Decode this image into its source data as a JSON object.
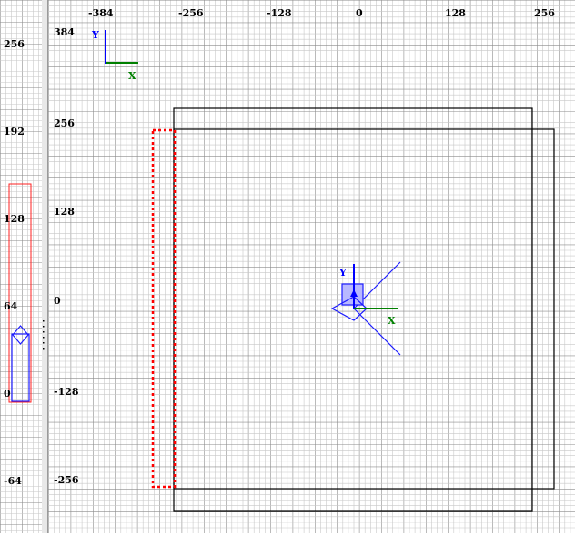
{
  "side_view": {
    "scale_labels": [
      "256",
      "192",
      "128",
      "64",
      "0",
      "-64"
    ]
  },
  "top_view": {
    "top_ruler": [
      "-384",
      "-256",
      "-128",
      "0",
      "128",
      "256"
    ],
    "left_ruler": [
      "384",
      "256",
      "128",
      "0",
      "-128",
      "-256"
    ],
    "corner_axis": {
      "y_label": "Y",
      "x_label": "X"
    },
    "origin_axis": {
      "y_label": "Y",
      "x_label": "X"
    }
  },
  "colors": {
    "grid_minor": "#c8c8c8",
    "grid_major": "#8c8c8c",
    "background": "#ffffff",
    "brush_outline": "#000000",
    "selection_dashed": "#ff0000",
    "entity_blue": "#1c1cff",
    "axis_x": "#008000",
    "axis_y": "#0000ff"
  }
}
